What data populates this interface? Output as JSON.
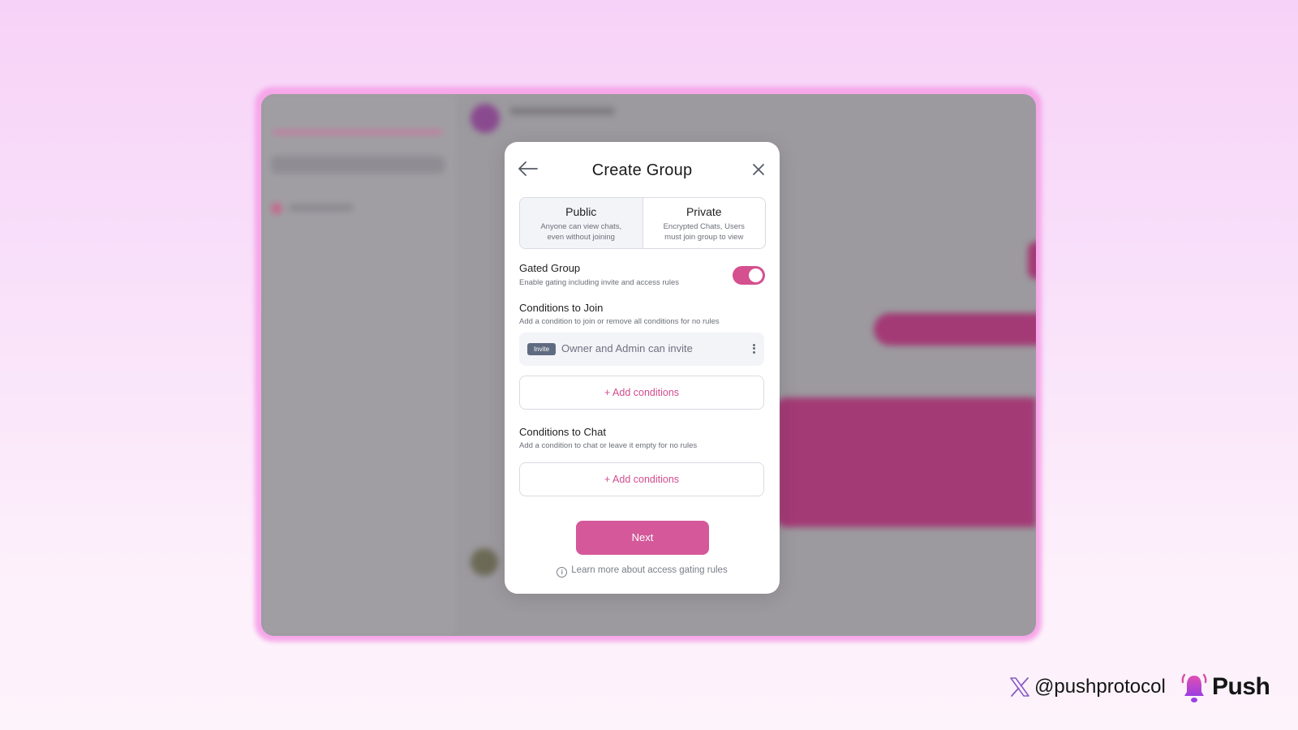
{
  "modal": {
    "title": "Create Group",
    "group_types": [
      {
        "label": "Public",
        "description": "Anyone can view chats, even without joining",
        "selected": true
      },
      {
        "label": "Private",
        "description": "Encrypted Chats, Users must join group to view",
        "selected": false
      }
    ],
    "gated_group": {
      "title": "Gated Group",
      "description": "Enable gating including invite and access rules",
      "enabled": true
    },
    "conditions_to_join": {
      "title": "Conditions to Join",
      "description": "Add a condition to join or remove all conditions for no rules",
      "items": [
        {
          "badge": "Invite",
          "label": "Owner and Admin can invite"
        }
      ],
      "add_label": "+ Add conditions"
    },
    "conditions_to_chat": {
      "title": "Conditions to Chat",
      "description": "Add a condition to chat or leave it empty for no rules",
      "add_label": "+ Add conditions"
    },
    "next_label": "Next",
    "learn_more_label": "Learn more about access gating rules"
  },
  "footer": {
    "handle": "@pushprotocol",
    "brand": "Push"
  },
  "colors": {
    "accent": "#d4589a",
    "accent_text": "#d14d8d",
    "background_top": "#f7d2f8",
    "background_bottom": "#fdf3fb"
  },
  "icons": {
    "back": "arrow-left-icon",
    "close": "close-icon",
    "more": "kebab-menu-icon",
    "info": "info-icon",
    "x_logo": "x-logo-icon",
    "brand_logo": "push-bell-icon"
  }
}
